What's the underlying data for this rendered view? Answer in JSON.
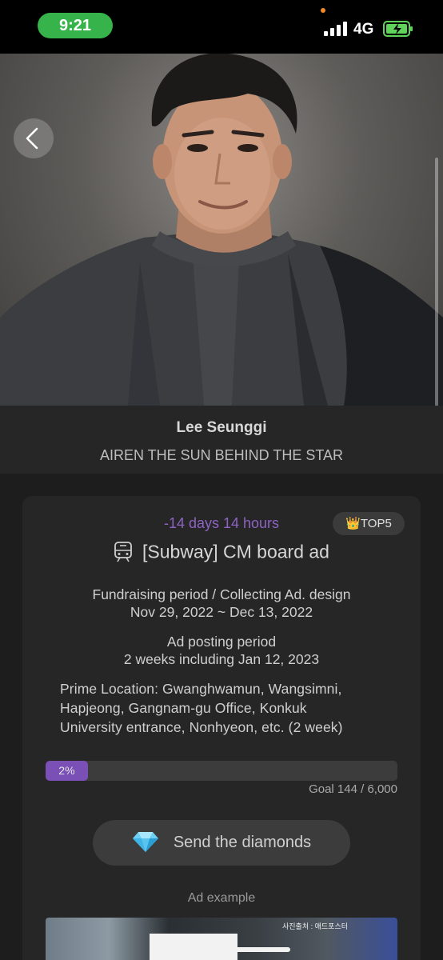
{
  "status_bar": {
    "time": "9:21",
    "network": "4G",
    "colors": {
      "time_pill": "#36b34a",
      "battery": "#5fd35a",
      "privacy_dot": "#f08a24"
    }
  },
  "hero": {
    "back_icon": "chevron-left-icon",
    "image_icon": "artist-photo"
  },
  "artist": {
    "name": "Lee Seunggi",
    "subtitle": "AIREN THE SUN BEHIND THE STAR"
  },
  "campaign": {
    "countdown": "-14 days 14 hours",
    "badge": "👑TOP5",
    "type_icon": "subway-icon",
    "title": "[Subway] CM board ad",
    "fundraising_label": "Fundraising period / Collecting Ad. design",
    "fundraising_dates": "Nov 29, 2022 ~ Dec 13, 2022",
    "posting_label": "Ad posting period",
    "posting_dates": "2 weeks including Jan 12, 2023",
    "location_lines": [
      "Prime Location: Gwanghwamun, Wangsimni,",
      "Hapjeong, Gangnam-gu Office, Konkuk",
      "University entrance, Nonhyeon, etc. (2 week)"
    ],
    "progress": {
      "percent": 2,
      "label": "2%"
    },
    "goal": "Goal 144 / 6,000",
    "send_button": {
      "icon": "diamond-icon",
      "label": "Send the diamonds"
    },
    "ad_example_label": "Ad example",
    "ad_image_caption": "사진출처 : 애드포스터",
    "colors": {
      "accent": "#8e63c4",
      "progress": "#7a4fb6"
    }
  }
}
